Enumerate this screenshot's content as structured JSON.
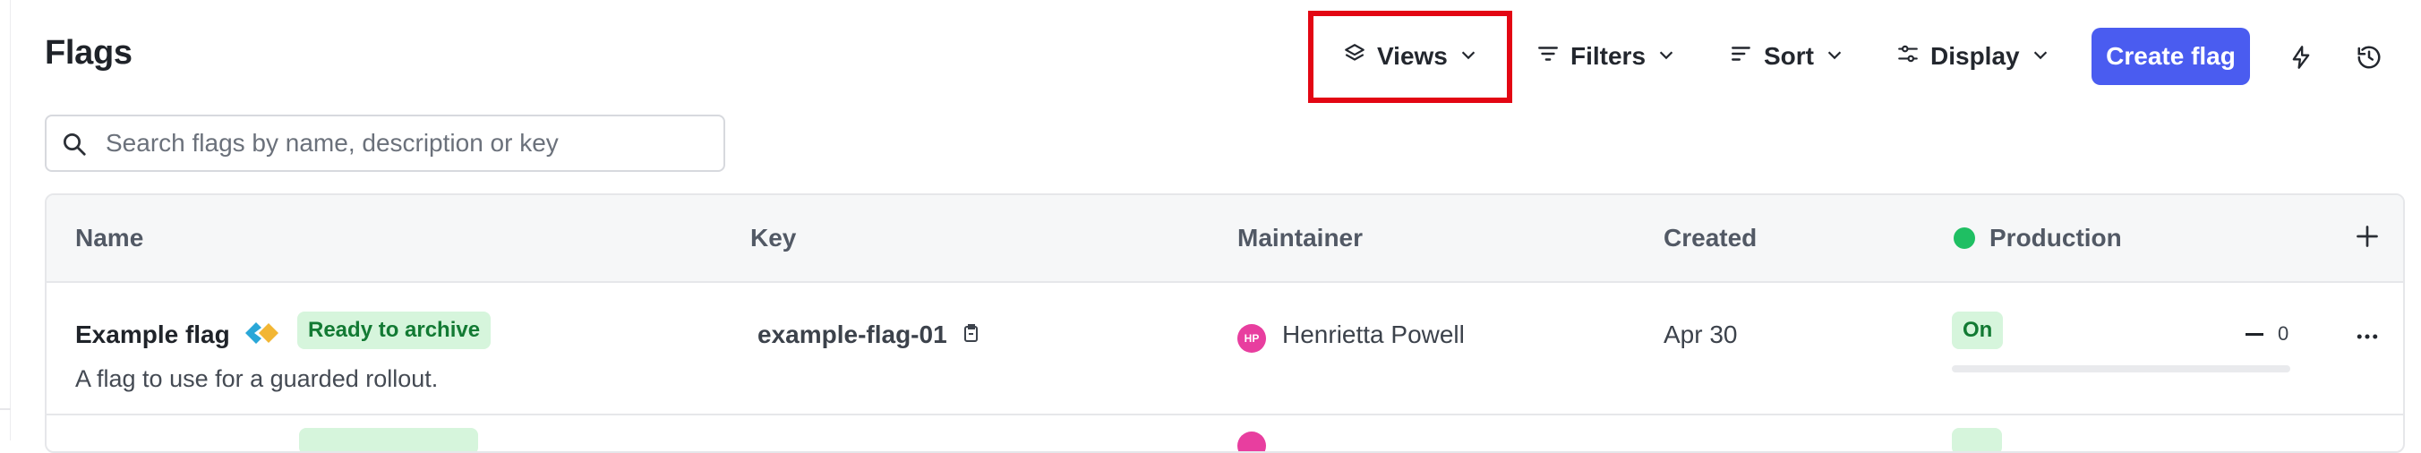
{
  "page": {
    "title": "Flags"
  },
  "toolbar": {
    "views_label": "Views",
    "filters_label": "Filters",
    "sort_label": "Sort",
    "display_label": "Display",
    "create_label": "Create flag",
    "icons": [
      "layers-icon",
      "filter-icon",
      "sort-icon",
      "sliders-icon",
      "lightning-icon",
      "history-icon"
    ]
  },
  "search": {
    "placeholder": "Search flags by name, description or key",
    "value": ""
  },
  "table": {
    "columns": [
      "Name",
      "Key",
      "Maintainer",
      "Created",
      "Production"
    ],
    "rows": [
      {
        "name": "Example flag",
        "badge": "Ready to archive",
        "description": "A flag to use for a guarded rollout.",
        "key": "example-flag-01",
        "maintainer_initials": "HP",
        "maintainer": "Henrietta Powell",
        "created": "Apr 30",
        "production_status": "On",
        "production_progress": 0,
        "count": "0"
      }
    ]
  },
  "colors": {
    "accent": "#4a5cf0",
    "highlight": "#e30613",
    "success": "#1fbf63",
    "badge_bg": "#d6f5dc",
    "avatar": "#e83e9f"
  }
}
